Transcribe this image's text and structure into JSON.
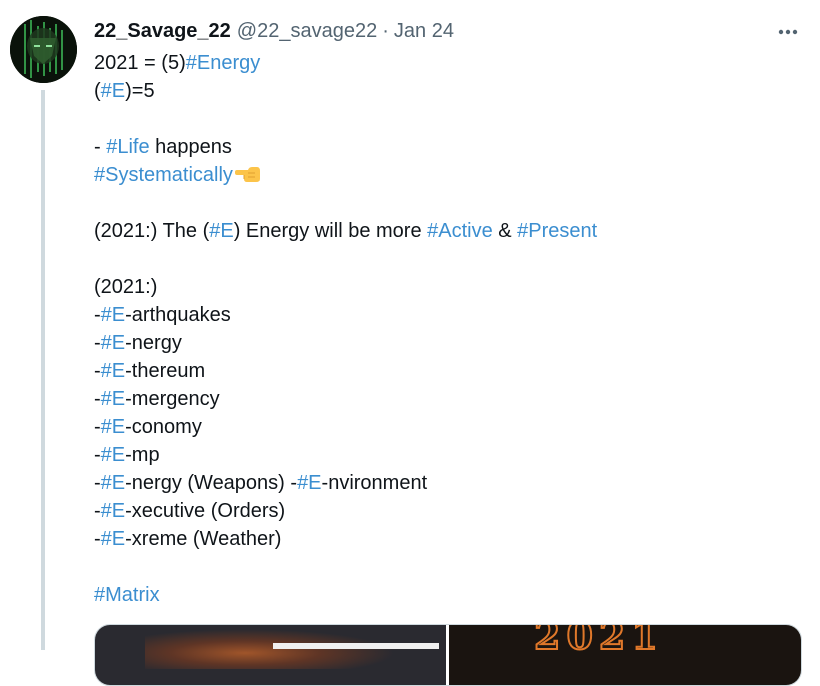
{
  "author": {
    "display_name": "22_Savage_22",
    "handle": "@22_savage22",
    "separator": "·",
    "date": "Jan 24"
  },
  "icons": {
    "more": "more-horizontal-icon",
    "hand": "backhand-index-pointing-left-icon",
    "avatar": "avatar-image"
  },
  "colors": {
    "hashtag": "#3b8ed0",
    "text": "#0f1419",
    "muted": "#536471",
    "thread_line": "#cfd9de"
  },
  "tweet": {
    "line1": {
      "pre": "2021 = (5)",
      "tag": "#Energy"
    },
    "line2": {
      "pre": "(",
      "tag": "#E",
      "post": ")=5"
    },
    "line3": {
      "pre": "- ",
      "tag": "#Life",
      "post": " happens"
    },
    "line4": {
      "tag": "#Systematically"
    },
    "line5": {
      "pre": "(2021:) The (",
      "tag1": "#E",
      "mid": ") Energy will be more ",
      "tag2": "#Active",
      "amp": " & ",
      "tag3": "#Present"
    },
    "line6": "(2021:)",
    "e_list": [
      {
        "dash": "-",
        "tag": "#E",
        "post": "-arthquakes"
      },
      {
        "dash": "-",
        "tag": "#E",
        "post": "-nergy"
      },
      {
        "dash": "-",
        "tag": "#E",
        "post": "-thereum"
      },
      {
        "dash": "-",
        "tag": "#E",
        "post": "-mergency"
      },
      {
        "dash": "-",
        "tag": "#E",
        "post": "-conomy"
      },
      {
        "dash": "-",
        "tag": "#E",
        "post": "-mp"
      },
      {
        "dash": "-",
        "tag": "#E",
        "post": "-nergy (Weapons) -",
        "tag2": "#E",
        "post2": "-nvironment"
      },
      {
        "dash": "-",
        "tag": "#E",
        "post": "-xecutive (Orders)"
      },
      {
        "dash": "-",
        "tag": "#E",
        "post": "-xreme (Weather)"
      }
    ],
    "closing_tag": "#Matrix"
  },
  "media": {
    "right_text": "2021"
  }
}
